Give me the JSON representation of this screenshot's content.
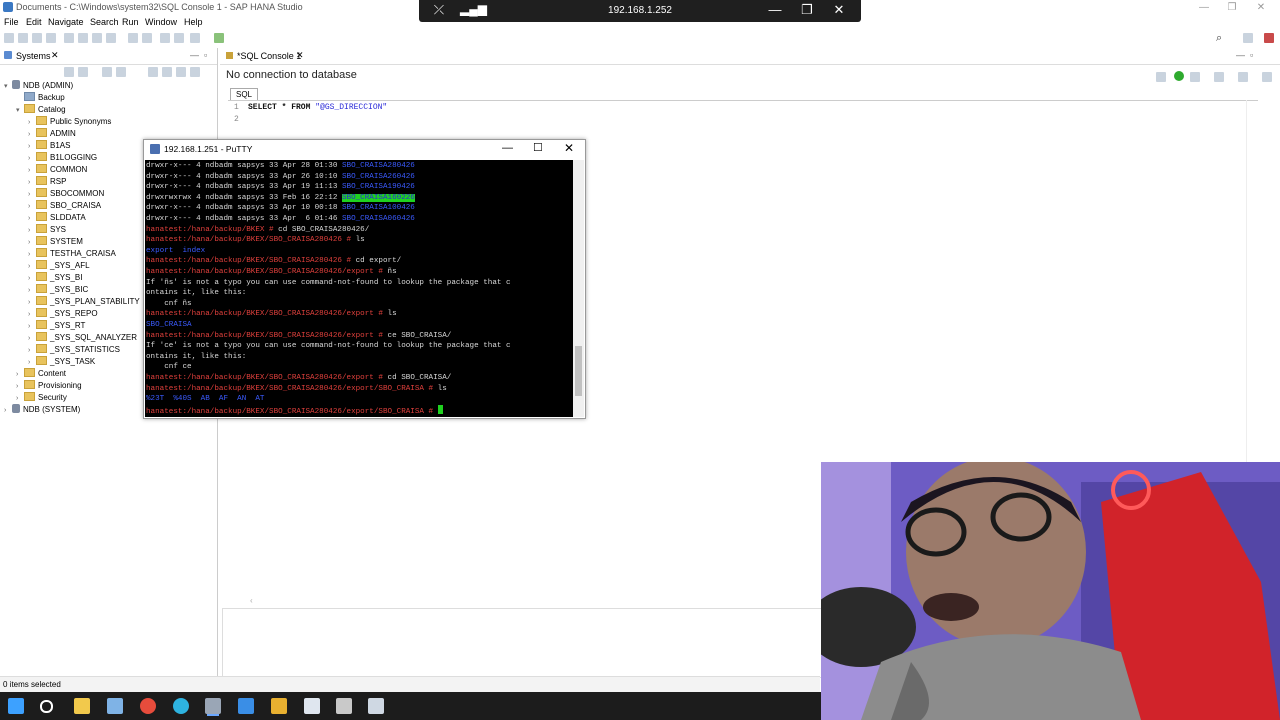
{
  "window": {
    "title": "Documents - C:\\Windows\\system32\\SQL Console 1 - SAP HANA Studio"
  },
  "rdp": {
    "ip": "192.168.1.252"
  },
  "menu": [
    "File",
    "Edit",
    "Navigate",
    "Search",
    "Run",
    "Window",
    "Help"
  ],
  "left_panel": {
    "tab_label": "Systems",
    "tree": [
      {
        "label": "NDB (ADMIN)",
        "level": 0,
        "kind": "db",
        "expanded": true
      },
      {
        "label": "Backup",
        "level": 1,
        "kind": "item"
      },
      {
        "label": "Catalog",
        "level": 1,
        "kind": "folder",
        "expanded": true
      },
      {
        "label": "Public Synonyms",
        "level": 2,
        "kind": "folder"
      },
      {
        "label": "ADMIN",
        "level": 2,
        "kind": "folder"
      },
      {
        "label": "B1AS",
        "level": 2,
        "kind": "folder"
      },
      {
        "label": "B1LOGGING",
        "level": 2,
        "kind": "folder"
      },
      {
        "label": "COMMON",
        "level": 2,
        "kind": "folder"
      },
      {
        "label": "RSP",
        "level": 2,
        "kind": "folder"
      },
      {
        "label": "SBOCOMMON",
        "level": 2,
        "kind": "folder"
      },
      {
        "label": "SBO_CRAISA",
        "level": 2,
        "kind": "folder"
      },
      {
        "label": "SLDDATA",
        "level": 2,
        "kind": "folder"
      },
      {
        "label": "SYS",
        "level": 2,
        "kind": "folder"
      },
      {
        "label": "SYSTEM",
        "level": 2,
        "kind": "folder"
      },
      {
        "label": "TESTHA_CRAISA",
        "level": 2,
        "kind": "folder"
      },
      {
        "label": "_SYS_AFL",
        "level": 2,
        "kind": "folder"
      },
      {
        "label": "_SYS_BI",
        "level": 2,
        "kind": "folder"
      },
      {
        "label": "_SYS_BIC",
        "level": 2,
        "kind": "folder"
      },
      {
        "label": "_SYS_PLAN_STABILITY",
        "level": 2,
        "kind": "folder"
      },
      {
        "label": "_SYS_REPO",
        "level": 2,
        "kind": "folder"
      },
      {
        "label": "_SYS_RT",
        "level": 2,
        "kind": "folder"
      },
      {
        "label": "_SYS_SQL_ANALYZER",
        "level": 2,
        "kind": "folder"
      },
      {
        "label": "_SYS_STATISTICS",
        "level": 2,
        "kind": "folder"
      },
      {
        "label": "_SYS_TASK",
        "level": 2,
        "kind": "folder"
      },
      {
        "label": "Content",
        "level": 1,
        "kind": "folder"
      },
      {
        "label": "Provisioning",
        "level": 1,
        "kind": "folder"
      },
      {
        "label": "Security",
        "level": 1,
        "kind": "folder"
      },
      {
        "label": "NDB (SYSTEM)",
        "level": 0,
        "kind": "db"
      }
    ]
  },
  "editor": {
    "tab_label": "*SQL Console 1",
    "connection_message": "No connection to database",
    "sql_tab": "SQL",
    "lines": [
      {
        "no": "1",
        "text": "SELECT * FROM \"@GS_DIRECCION\""
      },
      {
        "no": "2",
        "text": ""
      }
    ]
  },
  "putty": {
    "title": "192.168.1.251 - PuTTY",
    "lines": [
      {
        "parts": [
          {
            "t": "drwxr-x--- 4 ndbadm sapsys 33 Apr 28 01:30 ",
            "c": "w"
          },
          {
            "t": "SBO_CRAISA280426",
            "c": "b"
          }
        ]
      },
      {
        "parts": [
          {
            "t": "drwxr-x--- 4 ndbadm sapsys 33 Apr 26 10:10 ",
            "c": "w"
          },
          {
            "t": "SBO_CRAISA260426",
            "c": "b"
          }
        ]
      },
      {
        "parts": [
          {
            "t": "drwxr-x--- 4 ndbadm sapsys 33 Apr 19 11:13 ",
            "c": "w"
          },
          {
            "t": "SBO_CRAISA190426",
            "c": "b"
          }
        ]
      },
      {
        "parts": [
          {
            "t": "drwxrwxrwx 4 ndbadm sapsys 33 Feb 16 22:12 ",
            "c": "w"
          },
          {
            "t": "SBO_CRAISA160226",
            "c": "hl"
          }
        ]
      },
      {
        "parts": [
          {
            "t": "drwxr-x--- 4 ndbadm sapsys 33 Apr 10 00:18 ",
            "c": "w"
          },
          {
            "t": "SBO_CRAISA100426",
            "c": "b"
          }
        ]
      },
      {
        "parts": [
          {
            "t": "drwxr-x--- 4 ndbadm sapsys 33 Apr  6 01:46 ",
            "c": "w"
          },
          {
            "t": "SBO_CRAISA060426",
            "c": "b"
          }
        ]
      },
      {
        "parts": [
          {
            "t": "hanatest:/hana/backup/BKEX # ",
            "c": "r"
          },
          {
            "t": "cd SBO_CRAISA280426/",
            "c": "w"
          }
        ]
      },
      {
        "parts": [
          {
            "t": "hanatest:/hana/backup/BKEX/SBO_CRAISA280426 # ",
            "c": "r"
          },
          {
            "t": "ls",
            "c": "w"
          }
        ]
      },
      {
        "parts": [
          {
            "t": "export  index",
            "c": "b"
          }
        ]
      },
      {
        "parts": [
          {
            "t": "hanatest:/hana/backup/BKEX/SBO_CRAISA280426 # ",
            "c": "r"
          },
          {
            "t": "cd export/",
            "c": "w"
          }
        ]
      },
      {
        "parts": [
          {
            "t": "hanatest:/hana/backup/BKEX/SBO_CRAISA280426/export # ",
            "c": "r"
          },
          {
            "t": "ñs",
            "c": "w"
          }
        ]
      },
      {
        "parts": [
          {
            "t": "If 'ñs' is not a typo you can use command-not-found to lookup the package that c",
            "c": "w"
          }
        ]
      },
      {
        "parts": [
          {
            "t": "ontains it, like this:",
            "c": "w"
          }
        ]
      },
      {
        "parts": [
          {
            "t": "    cnf ñs",
            "c": "w"
          }
        ]
      },
      {
        "parts": [
          {
            "t": "hanatest:/hana/backup/BKEX/SBO_CRAISA280426/export # ",
            "c": "r"
          },
          {
            "t": "ls",
            "c": "w"
          }
        ]
      },
      {
        "parts": [
          {
            "t": "SBO_CRAISA",
            "c": "b"
          }
        ]
      },
      {
        "parts": [
          {
            "t": "hanatest:/hana/backup/BKEX/SBO_CRAISA280426/export # ",
            "c": "r"
          },
          {
            "t": "ce SBO_CRAISA/",
            "c": "w"
          }
        ]
      },
      {
        "parts": [
          {
            "t": "If 'ce' is not a typo you can use command-not-found to lookup the package that c",
            "c": "w"
          }
        ]
      },
      {
        "parts": [
          {
            "t": "ontains it, like this:",
            "c": "w"
          }
        ]
      },
      {
        "parts": [
          {
            "t": "    cnf ce",
            "c": "w"
          }
        ]
      },
      {
        "parts": [
          {
            "t": "hanatest:/hana/backup/BKEX/SBO_CRAISA280426/export # ",
            "c": "r"
          },
          {
            "t": "cd SBO_CRAISA/",
            "c": "w"
          }
        ]
      },
      {
        "parts": [
          {
            "t": "hanatest:/hana/backup/BKEX/SBO_CRAISA280426/export/SBO_CRAISA # ",
            "c": "r"
          },
          {
            "t": "ls",
            "c": "w"
          }
        ]
      },
      {
        "parts": [
          {
            "t": "%23T  %40S  AB  AF  AN  AT",
            "c": "b"
          }
        ]
      },
      {
        "parts": [
          {
            "t": "hanatest:/hana/backup/BKEX/SBO_CRAISA280426/export/SBO_CRAISA # ",
            "c": "r"
          },
          {
            "t": "",
            "c": "cursor"
          }
        ]
      }
    ]
  },
  "status": {
    "text": "0 items selected"
  },
  "colors": {
    "prompt": "#e0403c",
    "dir": "#3b5bff",
    "text": "#d9d9d9",
    "highlight_bg": "#1fd11f",
    "highlight_fg": "#2a2ad8"
  },
  "taskbar": {
    "icons": [
      "windows-start",
      "search",
      "file-explorer",
      "notepad",
      "chrome",
      "edge",
      "hana-studio",
      "onedrive",
      "slack",
      "explorer-window",
      "putty",
      "notes"
    ]
  }
}
